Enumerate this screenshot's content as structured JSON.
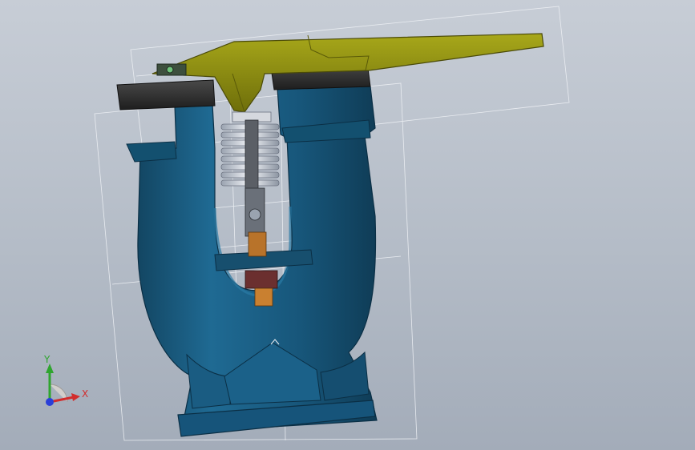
{
  "viewport": {
    "background_top": "#c7cdd6",
    "background_bottom": "#a3acb9"
  },
  "model": {
    "body_color": "#1b5c80",
    "body_shadow": "#0f3f5c",
    "flange_color": "#2d2d2d",
    "lever_color": "#8f8f10",
    "lever_edge": "#4a4a08",
    "spring_color": "#e6e8ee",
    "stem_color": "#b8732a",
    "seal_color": "#6b2f2f",
    "bbox_color": "#e9edf2"
  },
  "triad": {
    "x_label": "X",
    "y_label": "Y",
    "x_color": "#d22d2d",
    "y_color": "#2fa52f",
    "z_color": "#2a3fd8"
  }
}
